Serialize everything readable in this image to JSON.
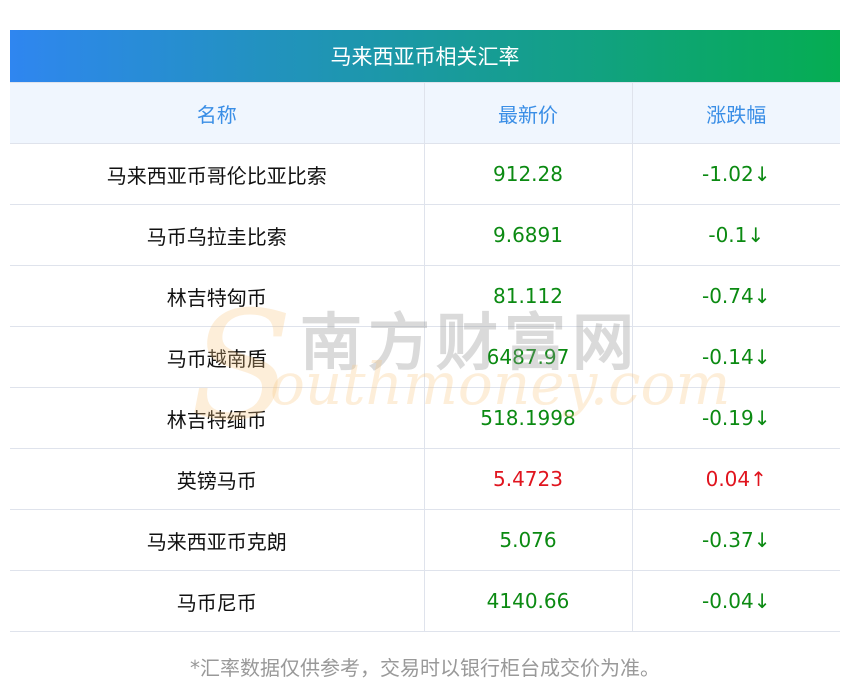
{
  "title": "马来西亚币相关汇率",
  "headers": [
    "名称",
    "最新价",
    "涨跌幅"
  ],
  "rows": [
    {
      "name": "马来西亚币哥伦比亚比索",
      "price": "912.28",
      "change": "-1.02↓",
      "dir": "down"
    },
    {
      "name": "马币乌拉圭比索",
      "price": "9.6891",
      "change": "-0.1↓",
      "dir": "down"
    },
    {
      "name": "林吉特匈币",
      "price": "81.112",
      "change": "-0.74↓",
      "dir": "down"
    },
    {
      "name": "马币越南盾",
      "price": "6487.97",
      "change": "-0.14↓",
      "dir": "down"
    },
    {
      "name": "林吉特缅币",
      "price": "518.1998",
      "change": "-0.19↓",
      "dir": "down"
    },
    {
      "name": "英镑马币",
      "price": "5.4723",
      "change": "0.04↑",
      "dir": "up"
    },
    {
      "name": "马来西亚币克朗",
      "price": "5.076",
      "change": "-0.37↓",
      "dir": "down"
    },
    {
      "name": "马币尼币",
      "price": "4140.66",
      "change": "-0.04↓",
      "dir": "down"
    }
  ],
  "footer": "*汇率数据仅供参考，交易时以银行柜台成交价为准。",
  "watermark": {
    "cn": "南方财富网",
    "en": "outhmoney.com",
    "s": "S"
  },
  "colors": {
    "down": "#0b8a12",
    "up": "#e0141e",
    "header": "#3a8ee6"
  }
}
